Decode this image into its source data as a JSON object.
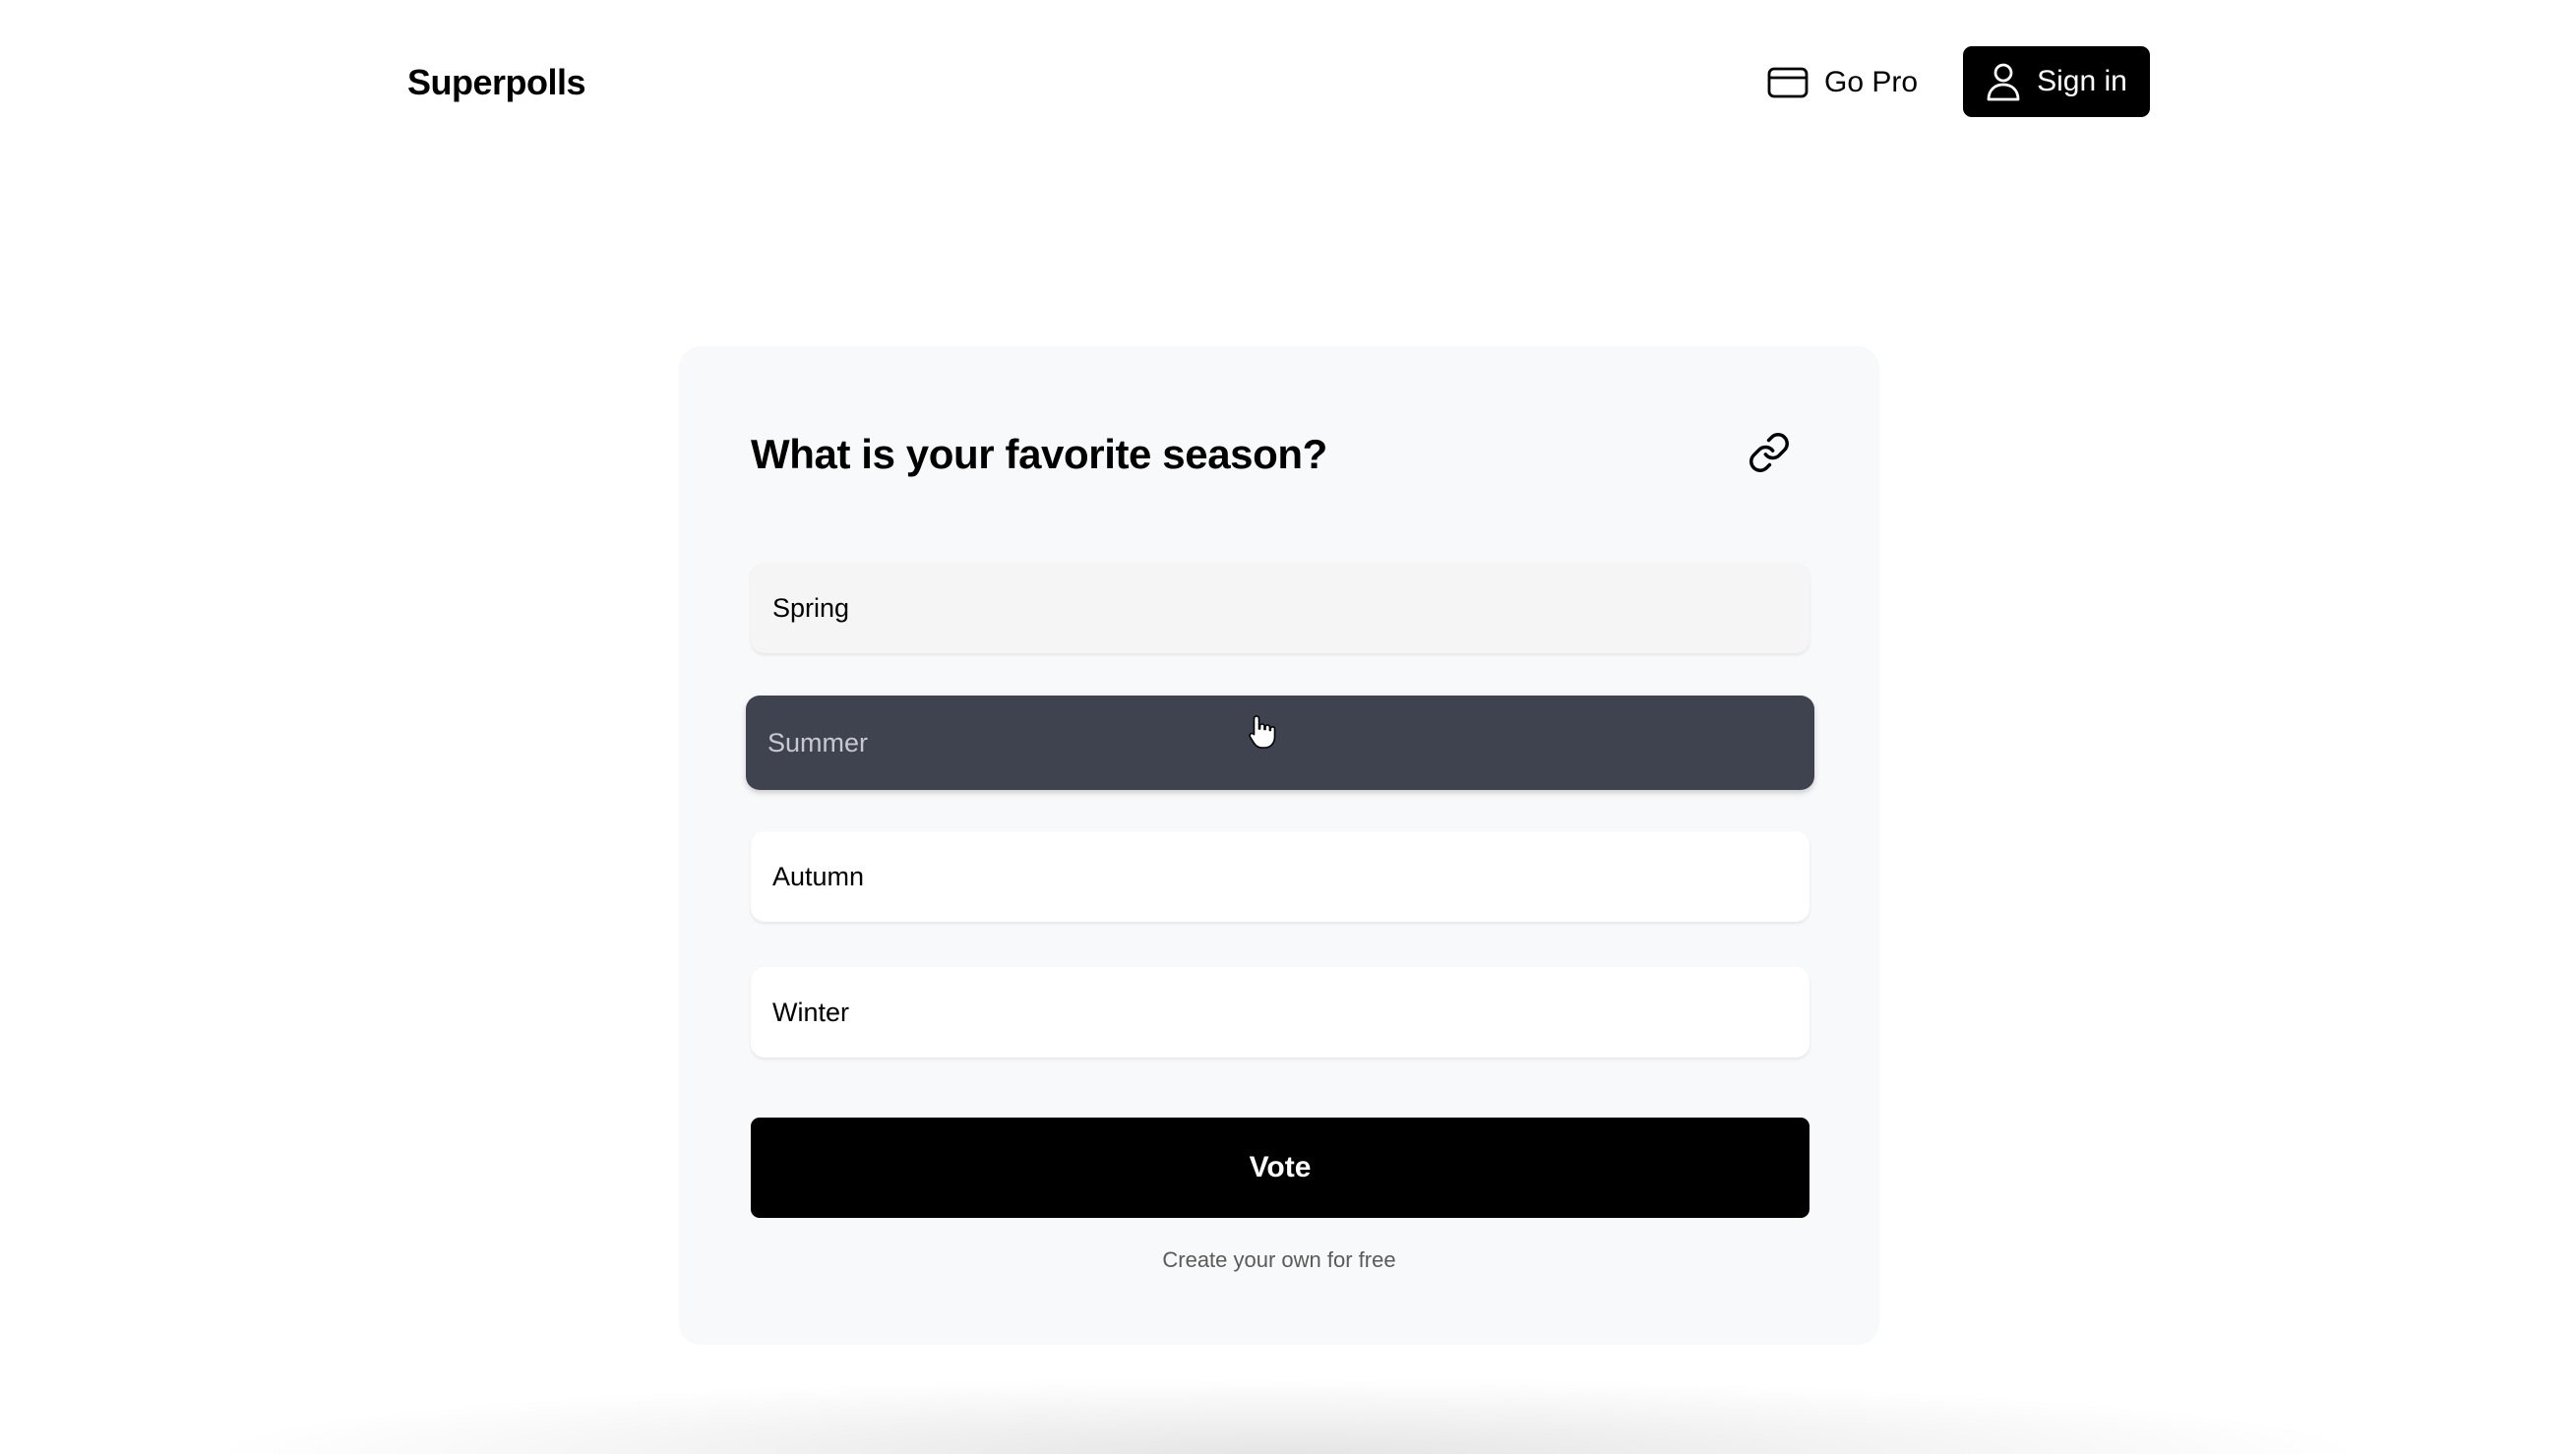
{
  "header": {
    "brand": "Superpolls",
    "go_pro_label": "Go Pro",
    "sign_in_label": "Sign in",
    "go_pro_icon": "credit-card-icon",
    "sign_in_icon": "user-icon"
  },
  "poll": {
    "question": "What is your favorite season?",
    "share_icon": "link-icon",
    "options": [
      {
        "label": "Spring"
      },
      {
        "label": "Summer"
      },
      {
        "label": "Autumn"
      },
      {
        "label": "Winter"
      }
    ],
    "vote_label": "Vote",
    "footer_link": "Create your own for free"
  },
  "colors": {
    "accent": "#000000",
    "hover_option_bg": "#3f424f",
    "card_bg": "#f8f9fa"
  }
}
